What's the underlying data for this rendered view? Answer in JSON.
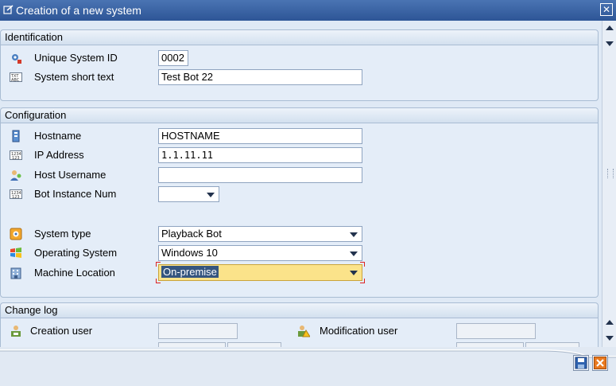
{
  "window": {
    "title": "Creation of a new system",
    "close_glyph": "✕"
  },
  "identification": {
    "header": "Identification",
    "unique_id": {
      "label": "Unique System ID",
      "value": "0002",
      "icon": "gear-id-icon"
    },
    "short_text": {
      "label": "System short text",
      "value": "Test Bot 22",
      "icon": "text-field-icon"
    }
  },
  "configuration": {
    "header": "Configuration",
    "hostname": {
      "label": "Hostname",
      "value": "HOSTNAME",
      "icon": "server-icon"
    },
    "ip_address": {
      "label": "IP Address",
      "value": "1.1.11.11",
      "icon": "numeric-field-icon"
    },
    "host_username": {
      "label": "Host Username",
      "value": "",
      "icon": "user-icon"
    },
    "bot_instance": {
      "label": "Bot Instance Num",
      "value": "",
      "icon": "numeric-field-icon"
    },
    "system_type": {
      "label": "System type",
      "value": "Playback Bot",
      "icon": "system-type-icon"
    },
    "operating_system": {
      "label": "Operating System",
      "value": "Windows 10",
      "icon": "windows-logo-icon"
    },
    "machine_location": {
      "label": "Machine Location",
      "value": "On-premise",
      "icon": "building-icon"
    }
  },
  "change_log": {
    "header": "Change log",
    "creation_user": {
      "label": "Creation user",
      "value": "",
      "icon": "user-create-icon"
    },
    "modification_user": {
      "label": "Modification user",
      "value": "",
      "icon": "user-modify-icon"
    }
  },
  "footer": {
    "save_icon": "save-icon",
    "cancel_icon": "cancel-icon"
  },
  "colors": {
    "titlebar": "#2d5596",
    "panel": "#e4edf8",
    "focus_field": "#fbe38a",
    "selection": "#35557f"
  }
}
